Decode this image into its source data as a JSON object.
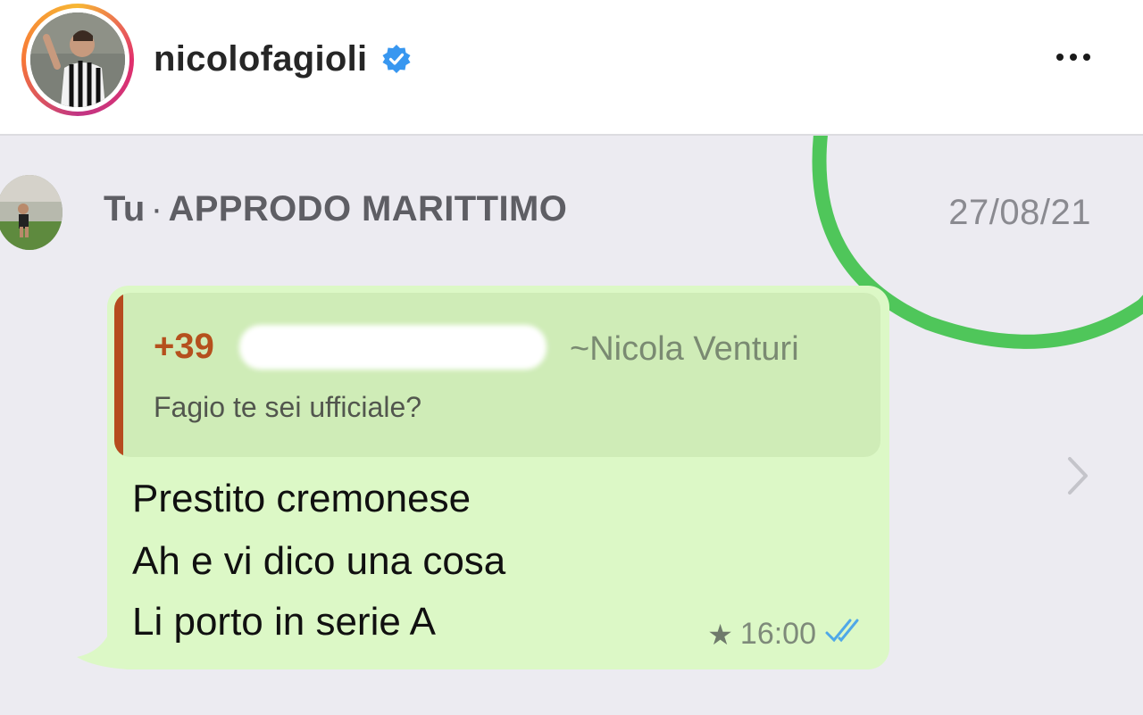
{
  "post_header": {
    "username": "nicolofagioli",
    "verified_icon": "verified-badge-icon",
    "more_icon": "more-options-icon"
  },
  "chat": {
    "sender": "Tu",
    "separator": "·",
    "group_name": "APPRODO MARITTIMO",
    "date": "27/08/21"
  },
  "message": {
    "quoted": {
      "phone_prefix": "+39",
      "sender_name": "~Nicola Venturi",
      "text": "Fagio te sei ufficiale?"
    },
    "lines": [
      "Prestito cremonese",
      "Ah e vi dico una cosa",
      "Li porto in serie A"
    ],
    "starred_icon": "star-icon",
    "time": "16:00",
    "status_icon": "double-check-icon"
  },
  "colors": {
    "bubble": "#dcf8c6",
    "quote_accent": "#b64b1f",
    "annotation_circle": "#4fc65a",
    "verified": "#3897f0",
    "read_ticks": "#4fa8e8"
  }
}
